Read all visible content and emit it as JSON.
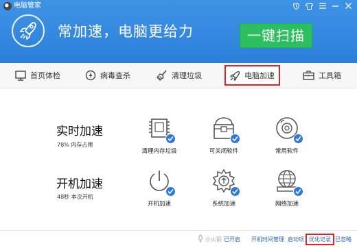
{
  "app": {
    "title": "电脑管家"
  },
  "header": {
    "slogan": "常加速，电脑更给力",
    "scan_label": "一键扫描"
  },
  "tabs": [
    {
      "label": "首页体检",
      "icon": "monitor-icon"
    },
    {
      "label": "病毒查杀",
      "icon": "bolt-shield-icon"
    },
    {
      "label": "清理垃圾",
      "icon": "broom-icon"
    },
    {
      "label": "电脑加速",
      "icon": "rocket-icon",
      "active": true
    },
    {
      "label": "工具箱",
      "icon": "toolbox-icon"
    }
  ],
  "realtime": {
    "title": "实时加速",
    "subtitle": "78% 内存占用",
    "items": [
      {
        "label": "清理内存垃圾",
        "icon": "memory-chip-icon"
      },
      {
        "label": "可关闭软件",
        "icon": "software-box-icon"
      },
      {
        "label": "常用软件",
        "icon": "disc-icon"
      }
    ]
  },
  "startup": {
    "title": "开机加速",
    "subtitle": "48秒 本次开机",
    "items": [
      {
        "label": "开机加速",
        "icon": "power-icon"
      },
      {
        "label": "系统加速",
        "icon": "gear-icon"
      },
      {
        "label": "网络加速",
        "icon": "globe-icon"
      }
    ]
  },
  "status": {
    "boost_name": "小火箭",
    "boost_state": "已开启",
    "links": [
      "开机时间管理",
      "启动项",
      "优化记录",
      "已忽略"
    ]
  },
  "colors": {
    "header_blue": "#3a8de2",
    "scan_green": "#2bc05d",
    "badge_blue": "#2e7ad6",
    "highlight_red": "#e02424"
  }
}
